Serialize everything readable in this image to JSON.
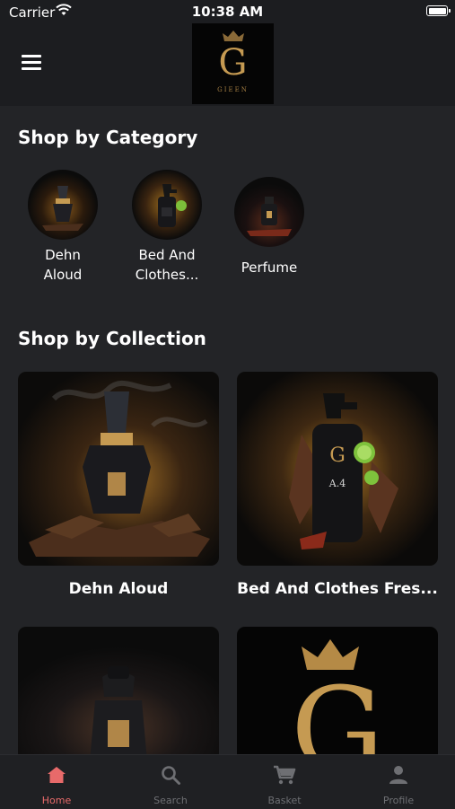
{
  "status_bar": {
    "carrier": "Carrier",
    "time": "10:38 AM"
  },
  "header": {
    "logo_letter": "G",
    "logo_word": "GIEEN"
  },
  "categories_section": {
    "title": "Shop by Category",
    "items": [
      {
        "label_line1": "Dehn",
        "label_line2": "Aloud"
      },
      {
        "label_line1": "Bed And",
        "label_line2": "Clothes..."
      },
      {
        "label_line1": "Perfume",
        "label_line2": ""
      }
    ]
  },
  "collections_section": {
    "title": "Shop by Collection",
    "items": [
      {
        "label": "Dehn Aloud"
      },
      {
        "label": "Bed And Clothes Fres..."
      },
      {
        "label": ""
      },
      {
        "label": ""
      }
    ]
  },
  "bottle_label": {
    "letter": "G",
    "code": "A.4"
  },
  "tab_bar": {
    "items": [
      {
        "label": "Home",
        "icon": "home-icon",
        "active": true
      },
      {
        "label": "Search",
        "icon": "search-icon",
        "active": false
      },
      {
        "label": "Basket",
        "icon": "cart-icon",
        "active": false
      },
      {
        "label": "Profile",
        "icon": "person-icon",
        "active": false
      }
    ]
  },
  "colors": {
    "background": "#232427",
    "bar": "#1c1d20",
    "accent": "#e86a6a",
    "gold": "#c59a52",
    "tab_inactive": "#6e6f73"
  }
}
